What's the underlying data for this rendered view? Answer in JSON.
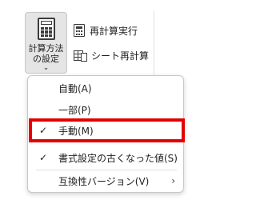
{
  "ribbon": {
    "calc_options": {
      "label_line1": "計算方法",
      "label_line2": "の設定",
      "chevron": "⌄",
      "icon": "calculator-icon"
    },
    "calculate_now": {
      "label": "再計算実行",
      "icon": "calculator-icon"
    },
    "calculate_sheet": {
      "label": "シート再計算",
      "icon": "sheet-calculator-icon"
    }
  },
  "menu": {
    "items": [
      {
        "label": "自動(A)",
        "checked": false
      },
      {
        "label": "一部(P)",
        "checked": false
      },
      {
        "label": "手動(M)",
        "checked": true
      },
      {
        "label": "書式設定の古くなった値(S)",
        "checked": true
      },
      {
        "label": "互換性バージョン(V)",
        "checked": false,
        "submenu": true
      }
    ],
    "check_glyph": "✓",
    "submenu_glyph": "›"
  },
  "colors": {
    "highlight": "#e30000",
    "pressed_button_bg": "#e5e5e5",
    "menu_bg": "#ffffff"
  }
}
